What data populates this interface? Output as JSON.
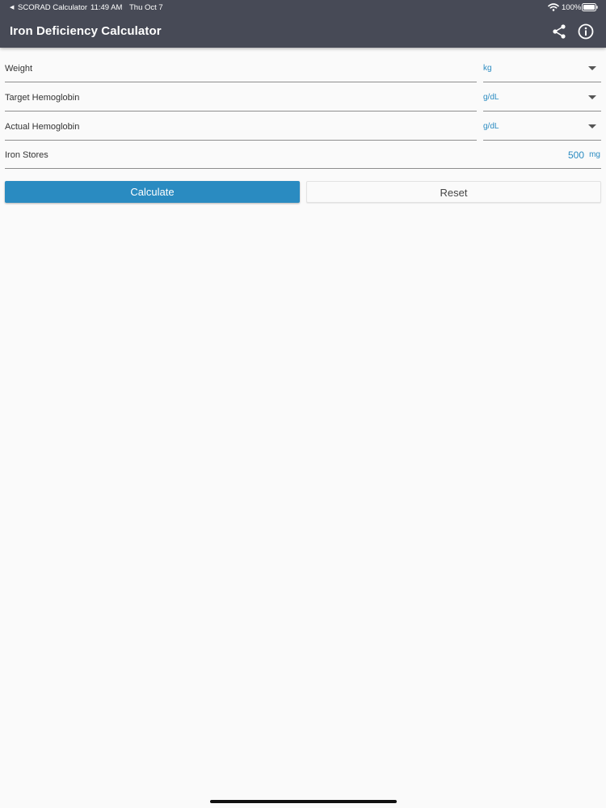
{
  "status_bar": {
    "back_app": "SCORAD Calculator",
    "time": "11:49 AM",
    "date": "Thu Oct 7",
    "battery": "100%"
  },
  "header": {
    "title": "Iron Deficiency Calculator",
    "actions": [
      "share-icon",
      "info-icon"
    ]
  },
  "form": {
    "rows": [
      {
        "label": "Weight",
        "value": "",
        "unit": "kg"
      },
      {
        "label": "Target Hemoglobin",
        "value": "",
        "unit": "g/dL"
      },
      {
        "label": "Actual Hemoglobin",
        "value": "",
        "unit": "g/dL"
      },
      {
        "label": "Iron Stores",
        "value": "500",
        "unit": "mg"
      }
    ]
  },
  "buttons": {
    "calculate": "Calculate",
    "reset": "Reset"
  },
  "colors": {
    "appbar": "#474a56",
    "accent": "#2a8bc1",
    "background": "#fafafa"
  }
}
